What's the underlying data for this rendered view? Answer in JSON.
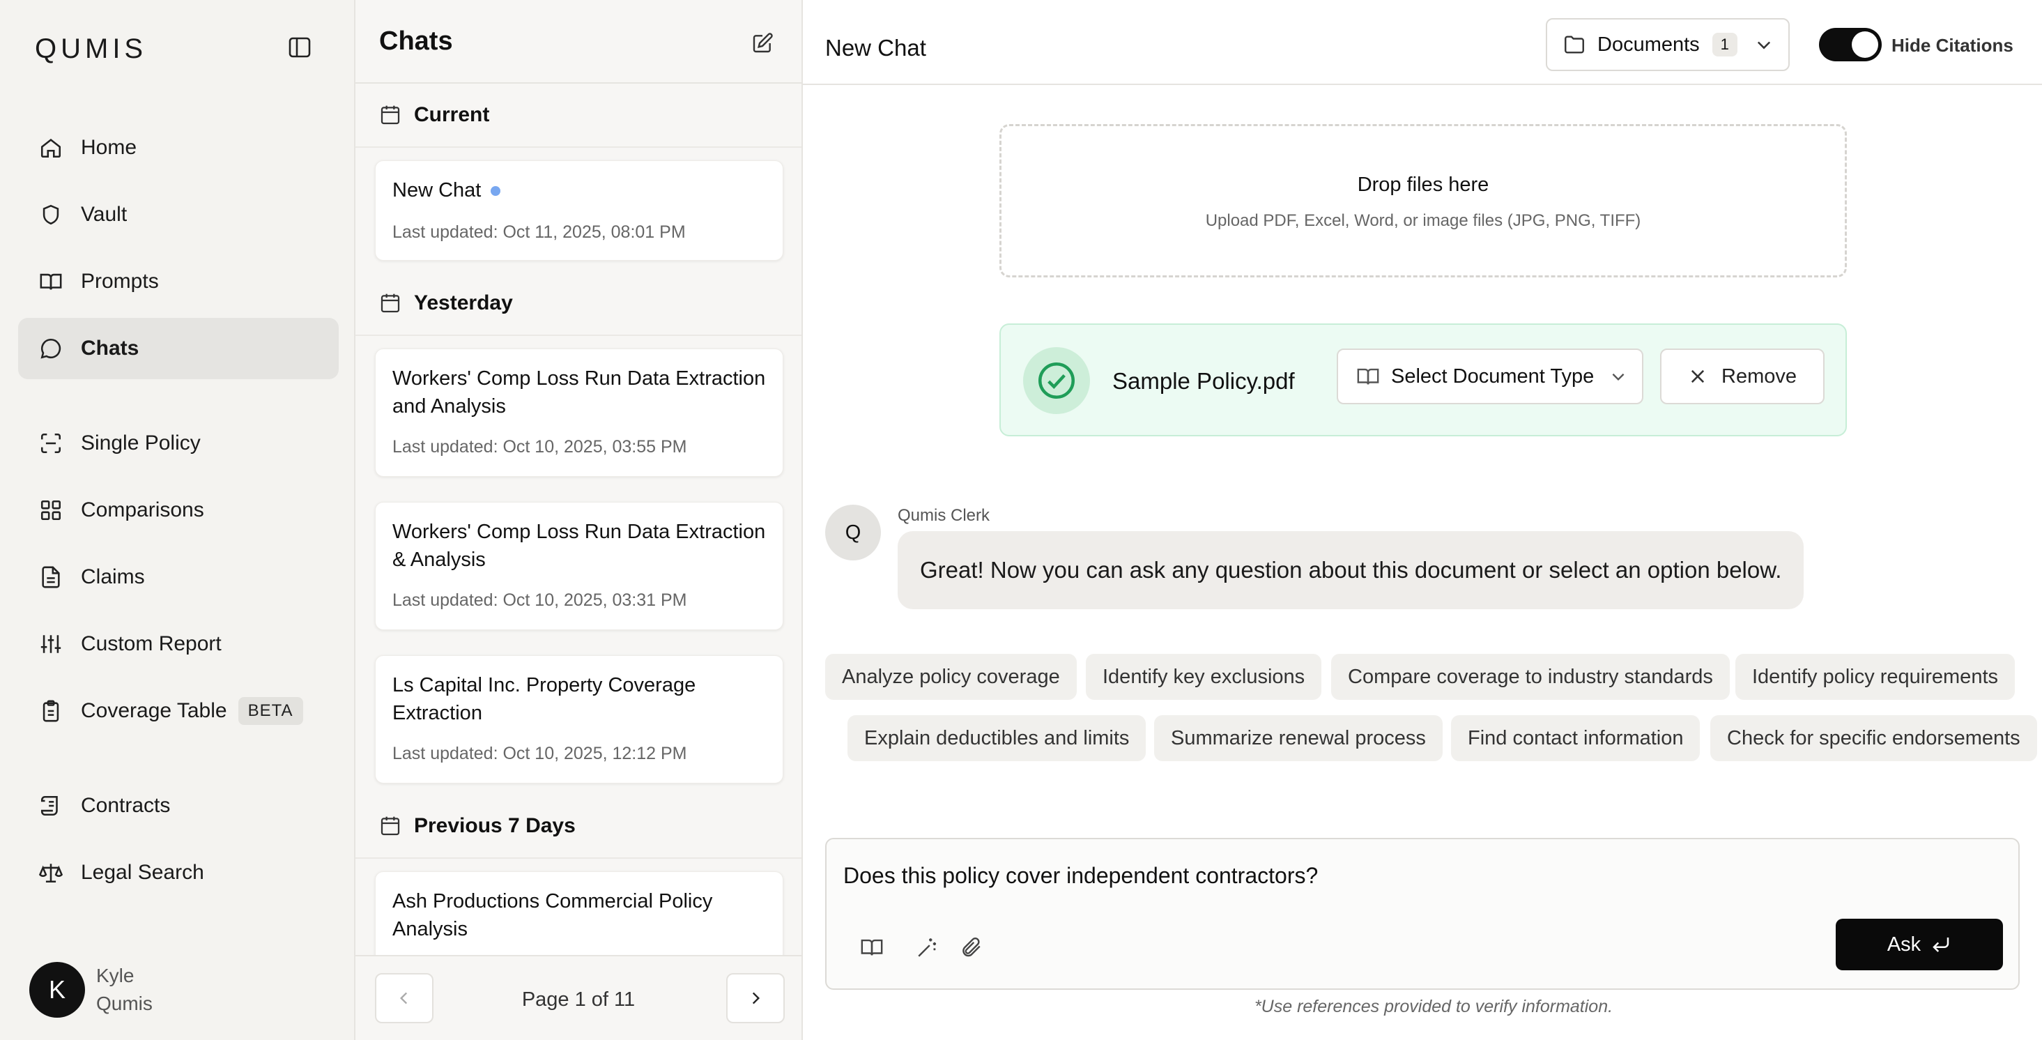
{
  "brand": "QUMIS",
  "nav": {
    "items": [
      {
        "label": "Home",
        "icon": "home-icon"
      },
      {
        "label": "Vault",
        "icon": "shield-icon"
      },
      {
        "label": "Prompts",
        "icon": "book-icon"
      },
      {
        "label": "Chats",
        "icon": "chat-icon",
        "active": true
      },
      {
        "label": "Single Policy",
        "icon": "scan-icon"
      },
      {
        "label": "Comparisons",
        "icon": "grid-icon"
      },
      {
        "label": "Claims",
        "icon": "document-icon"
      },
      {
        "label": "Custom Report",
        "icon": "sliders-icon"
      },
      {
        "label": "Coverage Table",
        "icon": "clipboard-icon",
        "badge": "BETA"
      },
      {
        "label": "Contracts",
        "icon": "scroll-icon"
      },
      {
        "label": "Legal Search",
        "icon": "scale-icon"
      }
    ],
    "user": {
      "initial": "K",
      "first": "Kyle",
      "last": "Qumis"
    }
  },
  "chats": {
    "title": "Chats",
    "groups": {
      "current": "Current",
      "yesterday": "Yesterday",
      "previous": "Previous 7 Days"
    },
    "items": [
      {
        "title": "New Chat",
        "meta": "Last updated: Oct 11, 2025, 08:01 PM"
      },
      {
        "title": "Workers' Comp Loss Run Data Extraction and Analysis",
        "meta": "Last updated: Oct 10, 2025, 03:55 PM"
      },
      {
        "title": "Workers' Comp Loss Run Data Extraction & Analysis",
        "meta": "Last updated: Oct 10, 2025, 03:31 PM"
      },
      {
        "title": "Ls Capital Inc. Property Coverage Extraction",
        "meta": "Last updated: Oct 10, 2025, 12:12 PM"
      },
      {
        "title": "Ash Productions Commercial Policy Analysis",
        "meta": ""
      }
    ],
    "pager": "Page 1 of 11"
  },
  "main": {
    "title": "New Chat",
    "documents_label": "Documents",
    "documents_count": "1",
    "citations_label": "Hide Citations",
    "dropzone": {
      "title": "Drop files here",
      "subtitle": "Upload PDF, Excel, Word, or image files (JPG, PNG, TIFF)"
    },
    "file": {
      "name": "Sample Policy.pdf",
      "select_label": "Select Document Type",
      "remove_label": "Remove"
    },
    "bot": {
      "initial": "Q",
      "name": "Qumis Clerk",
      "message": "Great! Now you can ask any question about this document or select an option below."
    },
    "suggestions": [
      "Analyze policy coverage",
      "Identify key exclusions",
      "Compare coverage to industry standards",
      "Identify policy requirements",
      "Explain deductibles and limits",
      "Summarize renewal process",
      "Find contact information",
      "Check for specific endorsements"
    ],
    "composer": {
      "text": "Does this policy cover independent contractors?",
      "ask_label": "Ask"
    },
    "footnote": "*Use references provided to verify information."
  }
}
